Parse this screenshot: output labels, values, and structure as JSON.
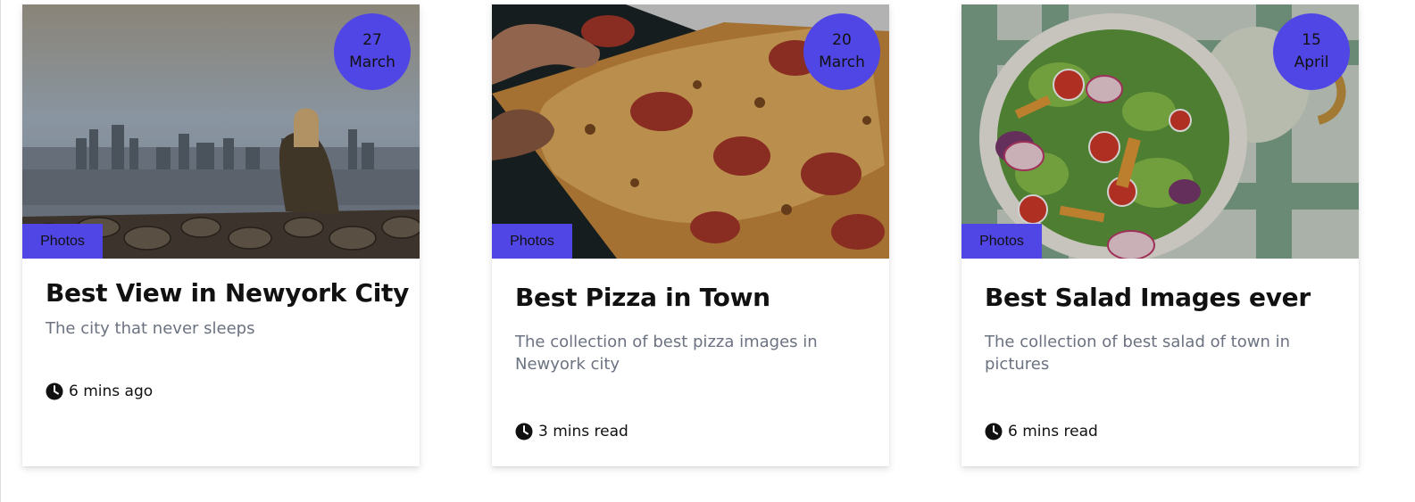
{
  "cards": [
    {
      "image_icon": "city-view-photo",
      "date_day": "27",
      "date_month": "March",
      "category": "Photos",
      "title": "Best View in Newyork City",
      "description": "The city that never sleeps",
      "meta_icon": "clock-icon",
      "meta": "6 mins ago"
    },
    {
      "image_icon": "pizza-photo",
      "date_day": "20",
      "date_month": "March",
      "category": "Photos",
      "title": "Best Pizza in Town",
      "description": "The collection of best pizza images in Newyork city",
      "meta_icon": "clock-icon",
      "meta": "3 mins read"
    },
    {
      "image_icon": "salad-photo",
      "date_day": "15",
      "date_month": "April",
      "category": "Photos",
      "title": "Best Salad Images ever",
      "description": "The collection of best salad of town in pictures",
      "meta_icon": "clock-icon",
      "meta": "6 mins read"
    }
  ],
  "colors": {
    "accent": "#5046e5",
    "title": "#111111",
    "description": "#6b7280"
  }
}
